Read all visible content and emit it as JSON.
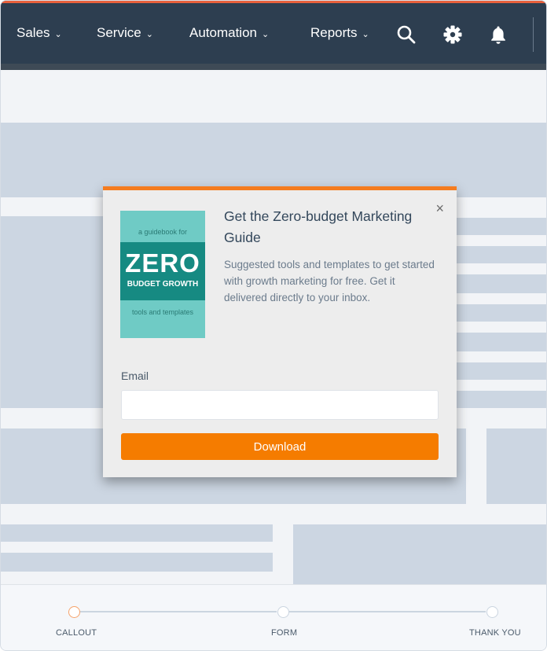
{
  "nav": {
    "items": [
      {
        "label": "Sales",
        "chevron": "⌄"
      },
      {
        "label": "Service",
        "chevron": "⌄"
      },
      {
        "label": "Automation",
        "chevron": "⌄"
      },
      {
        "label": "Reports",
        "chevron": "⌄"
      }
    ],
    "icons": [
      "search-icon",
      "gear-icon",
      "bell-icon"
    ]
  },
  "modal": {
    "title": "Get the Zero-budget Marketing Guide",
    "description": "Suggested tools and templates to get started with growth marketing for free. Get it delivered directly to your inbox.",
    "close": "×",
    "book": {
      "top_text": "a guidebook for",
      "big_text": "ZERO",
      "sub_text": "BUDGET GROWTH",
      "bottom_text": "tools and templates"
    },
    "email_label": "Email",
    "email_value": "",
    "email_placeholder": "",
    "download_label": "Download"
  },
  "stepper": {
    "steps": [
      {
        "label": "CALLOUT",
        "active": true
      },
      {
        "label": "FORM",
        "active": false
      },
      {
        "label": "THANK YOU",
        "active": false
      }
    ]
  },
  "colors": {
    "nav_bg": "#2d3e50",
    "accent": "#f57c00",
    "wireframe": "#ccd6e2"
  }
}
